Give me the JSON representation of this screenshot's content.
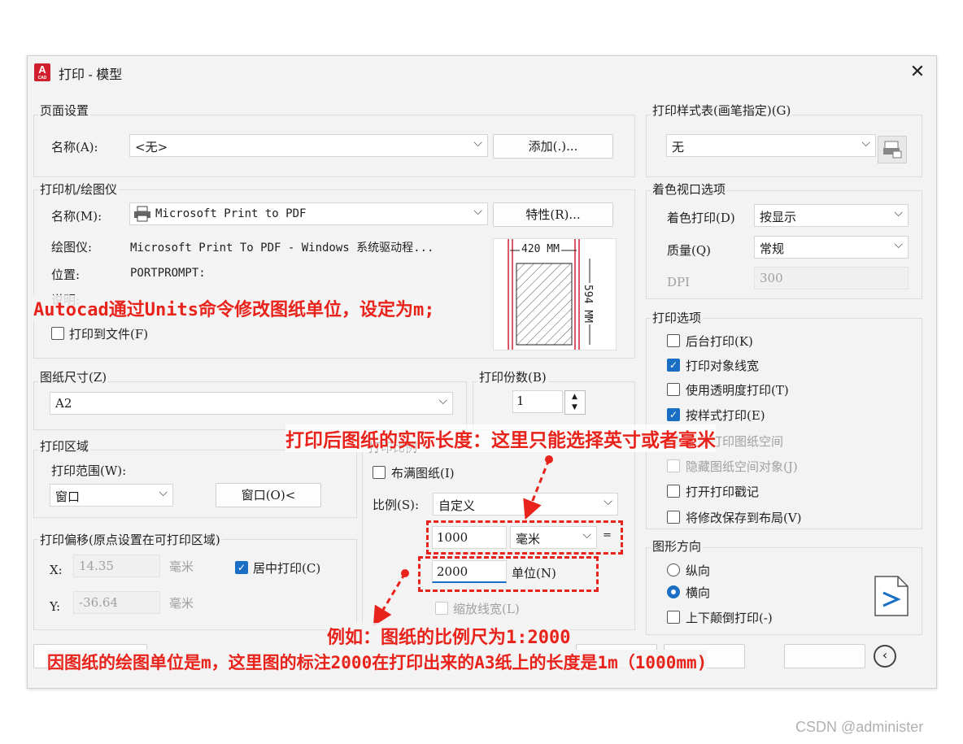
{
  "window": {
    "app_icon_letter": "A",
    "app_icon_sub": "CAD",
    "title": "打印 - 模型",
    "close": "✕"
  },
  "page_setup": {
    "group_title": "页面设置",
    "name_label": "名称(A):",
    "name_value": "<无>",
    "add_button": "添加(.)..."
  },
  "plotter": {
    "group_title": "打印机/绘图仪",
    "name_label": "名称(M):",
    "name_value": "Microsoft Print to PDF",
    "properties_button": "特性(R)...",
    "plotter_label": "绘图仪:",
    "plotter_value": "Microsoft Print To PDF - Windows 系统驱动程...",
    "location_label": "位置:",
    "location_value": "PORTPROMPT:",
    "description_label": "说明:",
    "print_to_file": "打印到文件(F)",
    "preview_width": "420 MM",
    "preview_height": "594 MM"
  },
  "paper_size": {
    "group_title": "图纸尺寸(Z)",
    "value": "A2"
  },
  "copies": {
    "group_title": "打印份数(B)",
    "value": "1"
  },
  "plot_area": {
    "group_title": "打印区域",
    "range_label": "打印范围(W):",
    "range_value": "窗口",
    "window_button": "窗口(O)<"
  },
  "plot_scale": {
    "group_title": "打印比例",
    "fit_paper": "布满图纸(I)",
    "scale_label": "比例(S):",
    "scale_value": "自定义",
    "value_mm": "1000",
    "unit_value": "毫米",
    "equals": "=",
    "value_units": "2000",
    "units_label": "单位(N)",
    "scale_lineweights": "缩放线宽(L)"
  },
  "plot_offset": {
    "group_title": "打印偏移(原点设置在可打印区域)",
    "x_label": "X:",
    "x_value": "14.35",
    "x_unit": "毫米",
    "y_label": "Y:",
    "y_value": "-36.64",
    "y_unit": "毫米",
    "center_plot": "居中打印(C)"
  },
  "plot_style_table": {
    "group_title": "打印样式表(画笔指定)(G)",
    "value": "无"
  },
  "shaded_viewport": {
    "group_title": "着色视口选项",
    "shade_label": "着色打印(D)",
    "shade_value": "按显示",
    "quality_label": "质量(Q)",
    "quality_value": "常规",
    "dpi_label": "DPI",
    "dpi_value": "300"
  },
  "plot_options": {
    "group_title": "打印选项",
    "items": [
      {
        "label": "后台打印(K)",
        "checked": false
      },
      {
        "label": "打印对象线宽",
        "checked": true
      },
      {
        "label": "使用透明度打印(T)",
        "checked": false
      },
      {
        "label": "按样式打印(E)",
        "checked": true
      },
      {
        "label": "最后打印图纸空间",
        "checked": true
      },
      {
        "label": "隐藏图纸空间对象(J)",
        "checked": false
      },
      {
        "label": "打开打印戳记",
        "checked": false
      },
      {
        "label": "将修改保存到布局(V)",
        "checked": false
      }
    ]
  },
  "orientation": {
    "group_title": "图形方向",
    "portrait": "纵向",
    "landscape": "横向",
    "upside_down": "上下颠倒打印(-)"
  },
  "annotations": {
    "units_note": "Autocad通过Units命令修改图纸单位，设定为m;",
    "actual_length_note": "打印后图纸的实际长度：这里只能选择英寸或者毫米",
    "scale_example": "例如：图纸的比例尺为1:2000",
    "explanation": "因图纸的绘图单位是m，这里图的标注2000在打印出来的A3纸上的长度是1m（1000mm)"
  },
  "watermark": "CSDN @administer",
  "colors": {
    "annotation_red": "#e8231b",
    "checkbox_blue": "#1a6fc4"
  }
}
